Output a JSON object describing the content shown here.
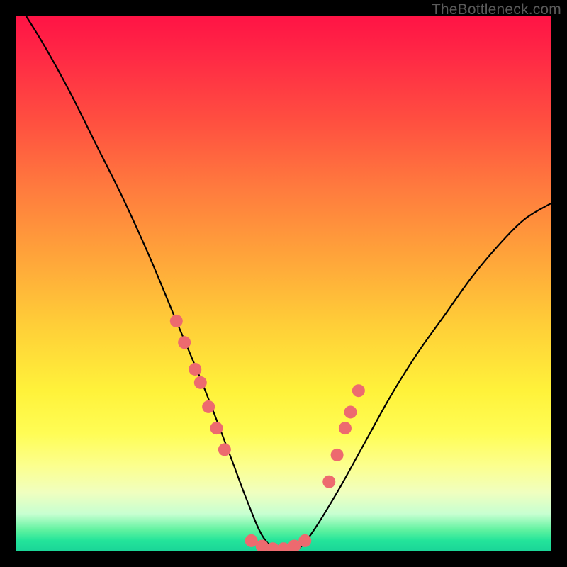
{
  "watermark": "TheBottleneck.com",
  "chart_data": {
    "type": "line",
    "title": "",
    "xlabel": "",
    "ylabel": "",
    "xlim": [
      0,
      100
    ],
    "ylim": [
      0,
      100
    ],
    "grid": false,
    "series": [
      {
        "name": "bottleneck-curve",
        "x": [
          0,
          5,
          10,
          15,
          20,
          25,
          30,
          35,
          40,
          43,
          46,
          49,
          52,
          55,
          60,
          65,
          70,
          75,
          80,
          85,
          90,
          95,
          100
        ],
        "y": [
          103,
          95,
          86,
          76,
          66,
          55,
          43,
          31,
          18,
          10,
          3,
          0,
          0,
          3,
          11,
          20,
          29,
          37,
          44,
          51,
          57,
          62,
          65
        ]
      }
    ],
    "markers": {
      "name": "highlight-dots",
      "color": "#ed6a6f",
      "points": [
        {
          "x": 30.0,
          "y": 43.0
        },
        {
          "x": 31.5,
          "y": 39.0
        },
        {
          "x": 33.5,
          "y": 34.0
        },
        {
          "x": 34.5,
          "y": 31.5
        },
        {
          "x": 36.0,
          "y": 27.0
        },
        {
          "x": 37.5,
          "y": 23.0
        },
        {
          "x": 39.0,
          "y": 19.0
        },
        {
          "x": 44.0,
          "y": 2.0
        },
        {
          "x": 46.0,
          "y": 1.0
        },
        {
          "x": 48.0,
          "y": 0.5
        },
        {
          "x": 50.0,
          "y": 0.5
        },
        {
          "x": 52.0,
          "y": 1.0
        },
        {
          "x": 54.0,
          "y": 2.0
        },
        {
          "x": 58.5,
          "y": 13.0
        },
        {
          "x": 60.0,
          "y": 18.0
        },
        {
          "x": 61.5,
          "y": 23.0
        },
        {
          "x": 62.5,
          "y": 26.0
        },
        {
          "x": 64.0,
          "y": 30.0
        }
      ]
    },
    "background_gradient": {
      "top": "#ff1345",
      "mid": "#ffe13a",
      "bottom": "#1ad598"
    }
  }
}
